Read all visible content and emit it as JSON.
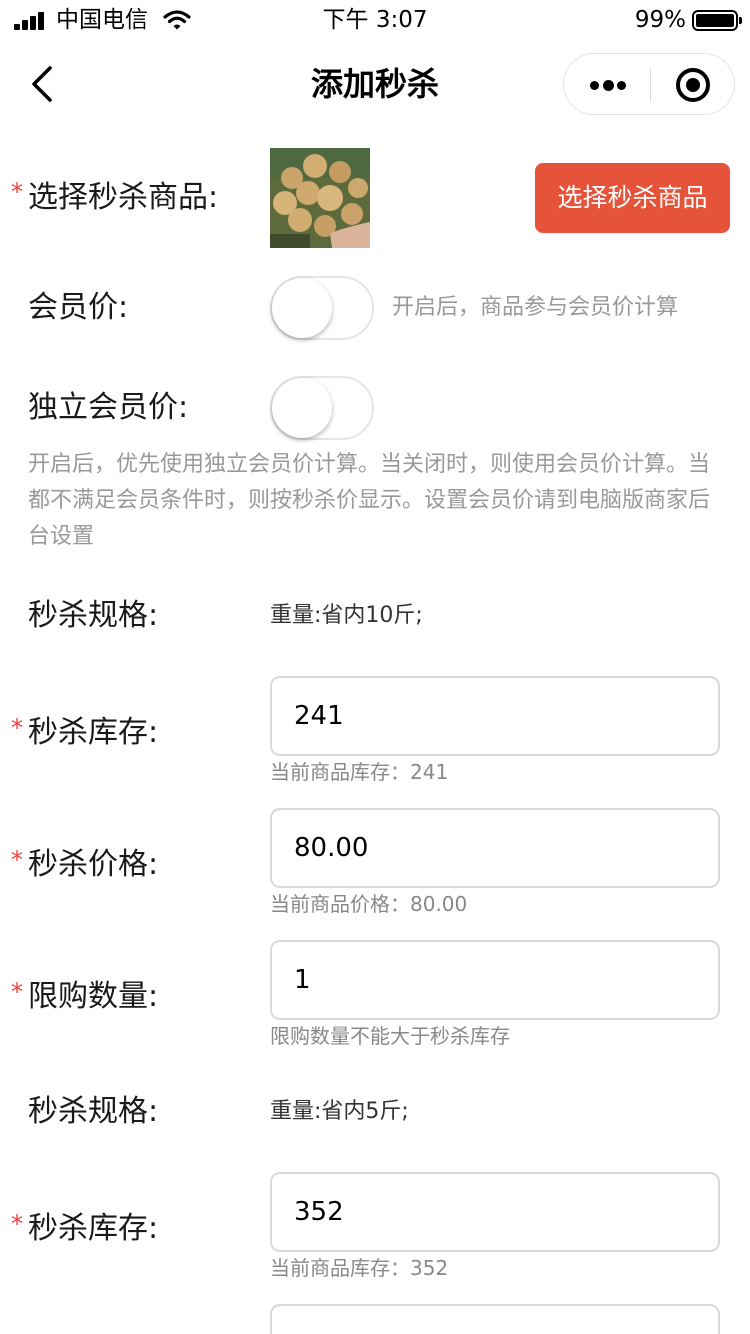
{
  "status_bar": {
    "carrier": "中国电信",
    "time": "下午 3:07",
    "battery": "99%"
  },
  "nav": {
    "title": "添加秒杀"
  },
  "form": {
    "product": {
      "label": "选择秒杀商品:",
      "button": "选择秒杀商品"
    },
    "member_price": {
      "label": "会员价:",
      "hint": "开启后，商品参与会员价计算",
      "enabled": false
    },
    "independent_member_price": {
      "label": "独立会员价:",
      "enabled": false,
      "hint": "开启后，优先使用独立会员价计算。当关闭时，则使用会员价计算。当都不满足会员条件时，则按秒杀价显示。设置会员价请到电脑版商家后台设置"
    },
    "specs": [
      {
        "spec_label": "秒杀规格:",
        "spec_value": "重量:省内10斤;",
        "stock_label": "秒杀库存:",
        "stock_value": "241",
        "stock_hint": "当前商品库存：241",
        "price_label": "秒杀价格:",
        "price_value": "80.00",
        "price_hint": "当前商品价格：80.00",
        "limit_label": "限购数量:",
        "limit_value": "1",
        "limit_hint": "限购数量不能大于秒杀库存"
      },
      {
        "spec_label": "秒杀规格:",
        "spec_value": "重量:省内5斤;",
        "stock_label": "秒杀库存:",
        "stock_value": "352",
        "stock_hint": "当前商品库存：352"
      }
    ],
    "required_mark": "*"
  },
  "colors": {
    "accent": "#e4533a",
    "required": "#e64340",
    "hint": "#999999"
  }
}
